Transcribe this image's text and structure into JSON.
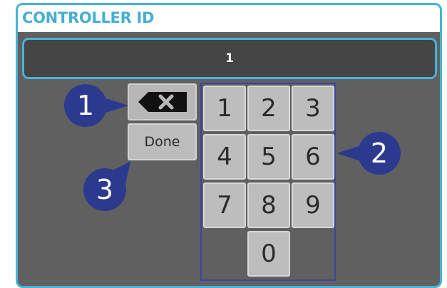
{
  "dialog": {
    "title": "CONTROLLER ID",
    "display_value": "1"
  },
  "keypad": {
    "keys": [
      "1",
      "2",
      "3",
      "4",
      "5",
      "6",
      "7",
      "8",
      "9",
      "0"
    ]
  },
  "actions": {
    "backspace_icon": "backspace-icon",
    "done_label": "Done"
  },
  "callouts": [
    "1",
    "2",
    "3"
  ],
  "colors": {
    "accent": "#49b2d6",
    "panel_background": "#606060",
    "display_background": "#454545",
    "key_background": "#bdbdbd",
    "callout_background": "#2b3a8f",
    "keypad_outline": "#3c45a0"
  }
}
